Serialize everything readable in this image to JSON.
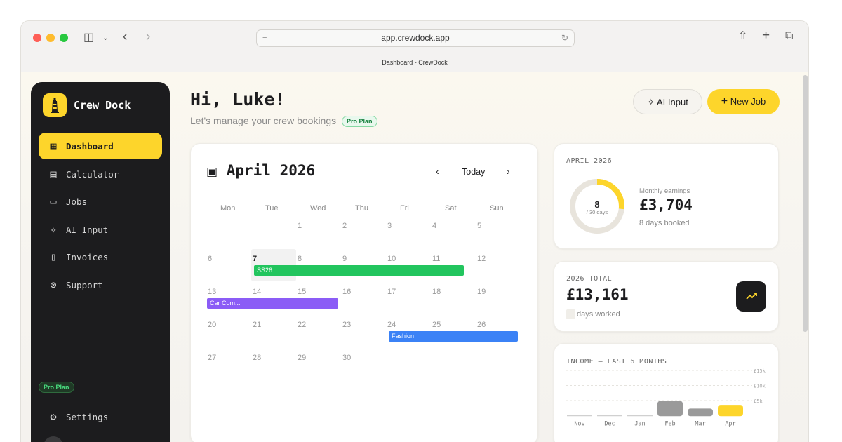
{
  "browser": {
    "url": "app.crewdock.app",
    "tab_title": "Dashboard - CrewDock"
  },
  "sidebar": {
    "brand": "Crew Dock",
    "items": [
      {
        "label": "Dashboard",
        "icon": "dashboard-icon",
        "glyph": "▦"
      },
      {
        "label": "Calculator",
        "icon": "calculator-icon",
        "glyph": "▤"
      },
      {
        "label": "Jobs",
        "icon": "folder-icon",
        "glyph": "▭"
      },
      {
        "label": "AI Input",
        "icon": "sparkles-icon",
        "glyph": "✧"
      },
      {
        "label": "Invoices",
        "icon": "document-icon",
        "glyph": "▯"
      },
      {
        "label": "Support",
        "icon": "lifebuoy-icon",
        "glyph": "⊗"
      }
    ],
    "plan_badge": "Pro Plan",
    "settings_label": "Settings"
  },
  "header": {
    "greeting": "Hi, Luke!",
    "subtitle": "Let's manage your crew bookings",
    "plan_badge": "Pro Plan",
    "ai_input_label": "AI Input",
    "new_job_label": "New Job"
  },
  "calendar": {
    "month_label": "April 2026",
    "today_label": "Today",
    "weekdays": [
      "Mon",
      "Tue",
      "Wed",
      "Thu",
      "Fri",
      "Sat",
      "Sun"
    ],
    "weeks": [
      [
        "",
        "",
        "1",
        "2",
        "3",
        "4",
        "5"
      ],
      [
        "6",
        "7",
        "8",
        "9",
        "10",
        "11",
        "12"
      ],
      [
        "13",
        "14",
        "15",
        "16",
        "17",
        "18",
        "19"
      ],
      [
        "20",
        "21",
        "22",
        "23",
        "24",
        "25",
        "26"
      ],
      [
        "27",
        "28",
        "29",
        "30",
        "",
        "",
        ""
      ]
    ],
    "today": "7",
    "events": [
      {
        "label": "SS26",
        "color": "#22c55e"
      },
      {
        "label": "Car Com...",
        "color": "#8b5cf6"
      },
      {
        "label": "Fashion",
        "color": "#3b82f6"
      }
    ]
  },
  "monthly": {
    "period": "APRIL 2026",
    "days": "8",
    "days_suffix": "/ 30 days",
    "days_fraction": 0.267,
    "earnings_label": "Monthly earnings",
    "earnings": "£3,704",
    "booked": "8 days booked"
  },
  "total": {
    "label": "2026 TOTAL",
    "amount": "£13,161",
    "days_worked": "days worked"
  },
  "income": {
    "title": "INCOME — LAST 6 MONTHS"
  },
  "chart_data": {
    "type": "bar",
    "title": "INCOME — LAST 6 MONTHS",
    "categories": [
      "Nov",
      "Dec",
      "Jan",
      "Feb",
      "Mar",
      "Apr"
    ],
    "values": [
      100,
      100,
      100,
      5000,
      2500,
      3704
    ],
    "y_ticks": [
      "£15k",
      "£10k",
      "£5k"
    ],
    "ylim": [
      0,
      15000
    ],
    "grid": true,
    "colors": {
      "default": "#9a9a9a",
      "current": "#fdd52b",
      "empty": "#d0d0d0"
    }
  },
  "colors": {
    "accent": "#fdd52b",
    "sidebar": "#1c1c1e",
    "pro_green": "#22c55e"
  }
}
